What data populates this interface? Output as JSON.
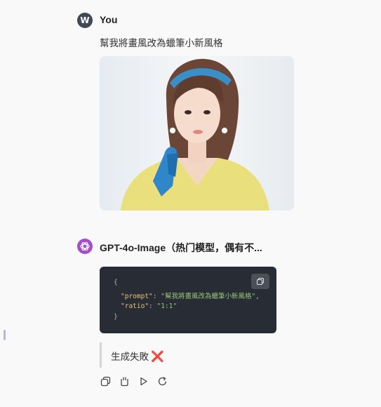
{
  "user": {
    "avatar_letter": "W",
    "name": "You",
    "message": "幫我將畫風改為蠟筆小新風格"
  },
  "assistant": {
    "name": "GPT-4o-Image（热门模型，偶有不...",
    "code": {
      "open_brace": "{",
      "close_brace": "}",
      "prompt_key": "\"prompt\"",
      "prompt_value": "\"幫我將畫風改為蠟筆小新風格\"",
      "ratio_key": "\"ratio\"",
      "ratio_value": "\"1:1\"",
      "colon": ": ",
      "comma": ","
    },
    "result_text": "生成失敗",
    "result_icon": "❌"
  },
  "colors": {
    "page_bg": "#f9f9f9",
    "user_avatar": "#3f4a56",
    "bot_avatar": "#a44fc8",
    "code_bg": "#282c34",
    "code_key": "#e5c07b",
    "code_string": "#98c379",
    "fail_cross": "#e0242b"
  },
  "icons": [
    "copy-icon",
    "copy-message-icon",
    "regenerate-icon",
    "play-icon",
    "refresh-icon",
    "openai-logo-icon"
  ]
}
